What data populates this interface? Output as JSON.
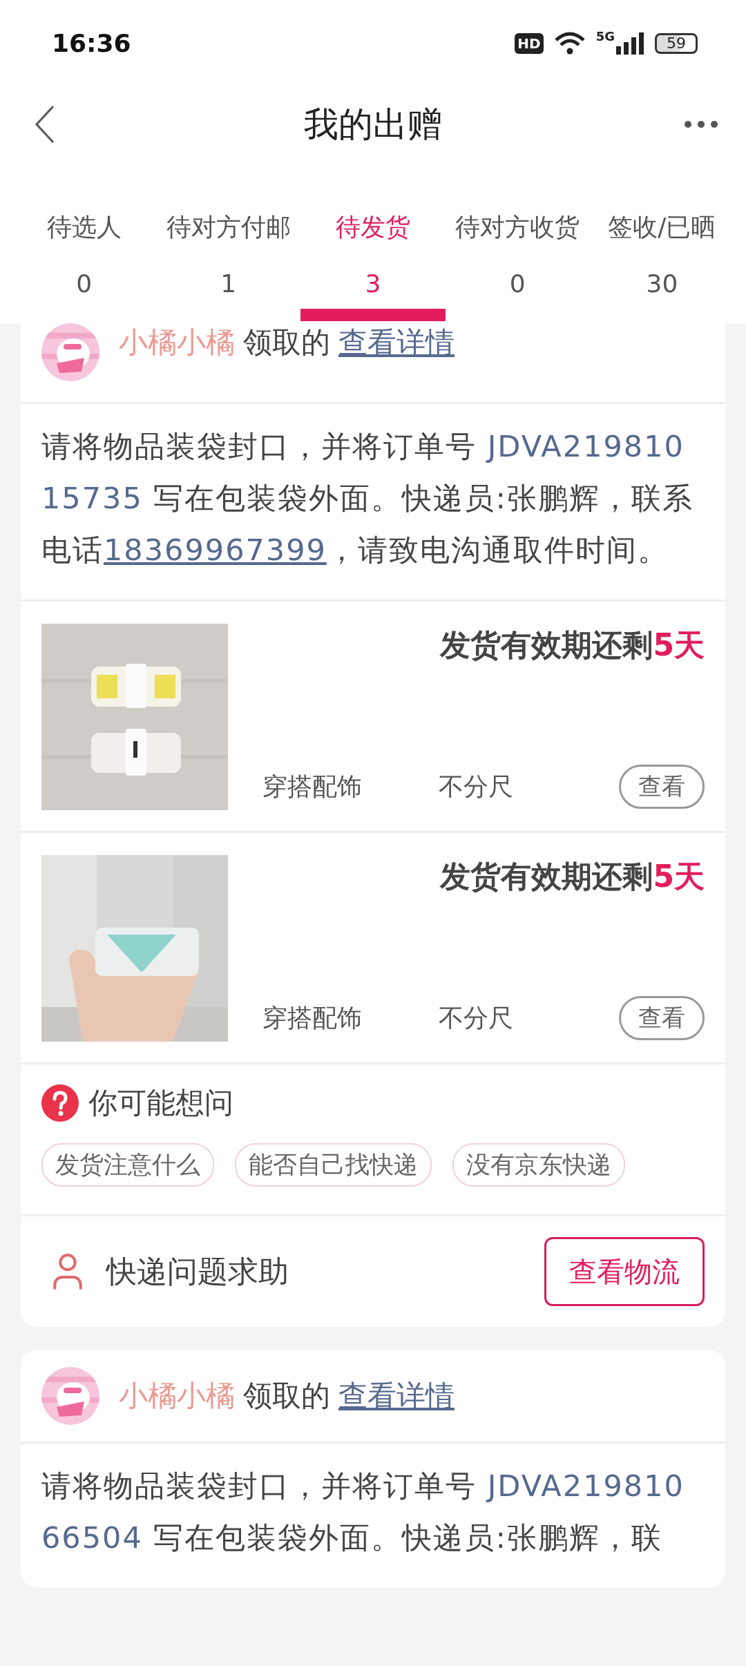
{
  "status_bar": {
    "time": "16:36",
    "hd": "HD",
    "network": "5G",
    "battery": "59"
  },
  "header": {
    "title": "我的出赠"
  },
  "tabs": [
    {
      "label": "待选人",
      "count": "0",
      "selected": false
    },
    {
      "label": "待对方付邮",
      "count": "1",
      "selected": false
    },
    {
      "label": "待发货",
      "count": "3",
      "selected": true
    },
    {
      "label": "待对方收货",
      "count": "0",
      "selected": false
    },
    {
      "label": "签收/已晒",
      "count": "30",
      "selected": false
    }
  ],
  "orders": [
    {
      "receiver": "小橘小橘",
      "action": "领取的",
      "details_link": "查看详情",
      "instruction": [
        {
          "kind": "text",
          "text": "请将物品装袋封口，并将订单号 "
        },
        {
          "kind": "highlight",
          "text": "JDVA21981015735"
        },
        {
          "kind": "text",
          "text": " 写在包装袋外面。快递员:张鹏辉，联系电话"
        },
        {
          "kind": "link",
          "text": "18369967399"
        },
        {
          "kind": "text",
          "text": "，请致电沟通取件时间。"
        }
      ],
      "items": [
        {
          "kind": "picture",
          "deadline": "发货有效期还剩",
          "days": "5天",
          "category": "穿搭配饰",
          "size": "不分尺",
          "button": "查看"
        },
        {
          "kind": "picture",
          "deadline": "发货有效期还剩",
          "days": "5天",
          "category": "穿搭配饰",
          "size": "不分尺",
          "button": "查看"
        }
      ],
      "faq": {
        "title": "你可能想问",
        "chips": [
          "发货注意什么",
          "能否自己找快递",
          "没有京东快递"
        ]
      },
      "help": {
        "label": "快递问题求助",
        "button": "查看物流"
      }
    },
    {
      "receiver": "小橘小橘",
      "action": "领取的",
      "details_link": "查看详情",
      "instruction": [
        {
          "kind": "text",
          "text": "请将物品装袋封口，并将订单号 "
        },
        {
          "kind": "highlight",
          "text": "JDVA21981066504"
        },
        {
          "kind": "text",
          "text": " 写在包装袋外面。快递员:张鹏辉，联"
        }
      ]
    }
  ]
}
